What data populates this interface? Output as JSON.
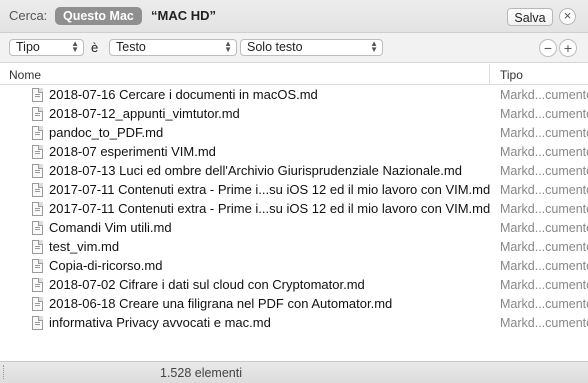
{
  "search": {
    "label": "Cerca:",
    "scope_active": "Questo Mac",
    "scope_other": "“MAC HD”",
    "save_label": "Salva",
    "close_glyph": "×"
  },
  "criteria": {
    "attribute": "Tipo",
    "conjunction": "è",
    "value": "Testo",
    "subtype": "Solo testo",
    "remove_glyph": "−",
    "add_glyph": "+"
  },
  "columns": {
    "name": "Nome",
    "type": "Tipo"
  },
  "files": [
    {
      "name": "2018-07-16 Cercare i documenti in macOS.md",
      "type": "Markd...cumento"
    },
    {
      "name": "2018-07-12_appunti_vimtutor.md",
      "type": "Markd...cumento"
    },
    {
      "name": "pandoc_to_PDF.md",
      "type": "Markd...cumento"
    },
    {
      "name": "2018-07 esperimenti VIM.md",
      "type": "Markd...cumento"
    },
    {
      "name": "2018-07-13 Luci ed ombre dell'Archivio Giurisprudenziale Nazionale.md",
      "type": "Markd...cumento"
    },
    {
      "name": "2017-07-11 Contenuti extra - Prime i...su iOS 12 ed il mio lavoro con VIM.md",
      "type": "Markd...cumento"
    },
    {
      "name": "2017-07-11 Contenuti extra - Prime i...su iOS 12 ed il mio lavoro con VIM.md",
      "type": "Markd...cumento"
    },
    {
      "name": "Comandi Vim utili.md",
      "type": "Markd...cumento"
    },
    {
      "name": "test_vim.md",
      "type": "Markd...cumento"
    },
    {
      "name": "Copia-di-ricorso.md",
      "type": "Markd...cumento"
    },
    {
      "name": "2018-07-02 Cifrare i dati sul cloud con Cryptomator.md",
      "type": "Markd...cumento"
    },
    {
      "name": "2018-06-18 Creare una filigrana nel PDF con Automator.md",
      "type": "Markd...cumento"
    },
    {
      "name": "informativa Privacy avvocati e mac.md",
      "type": "Markd...cumento"
    }
  ],
  "status": {
    "count": "1.528 elementi"
  },
  "icons": {
    "file": "markdown-file-icon",
    "popup": "updown-arrows-icon"
  }
}
